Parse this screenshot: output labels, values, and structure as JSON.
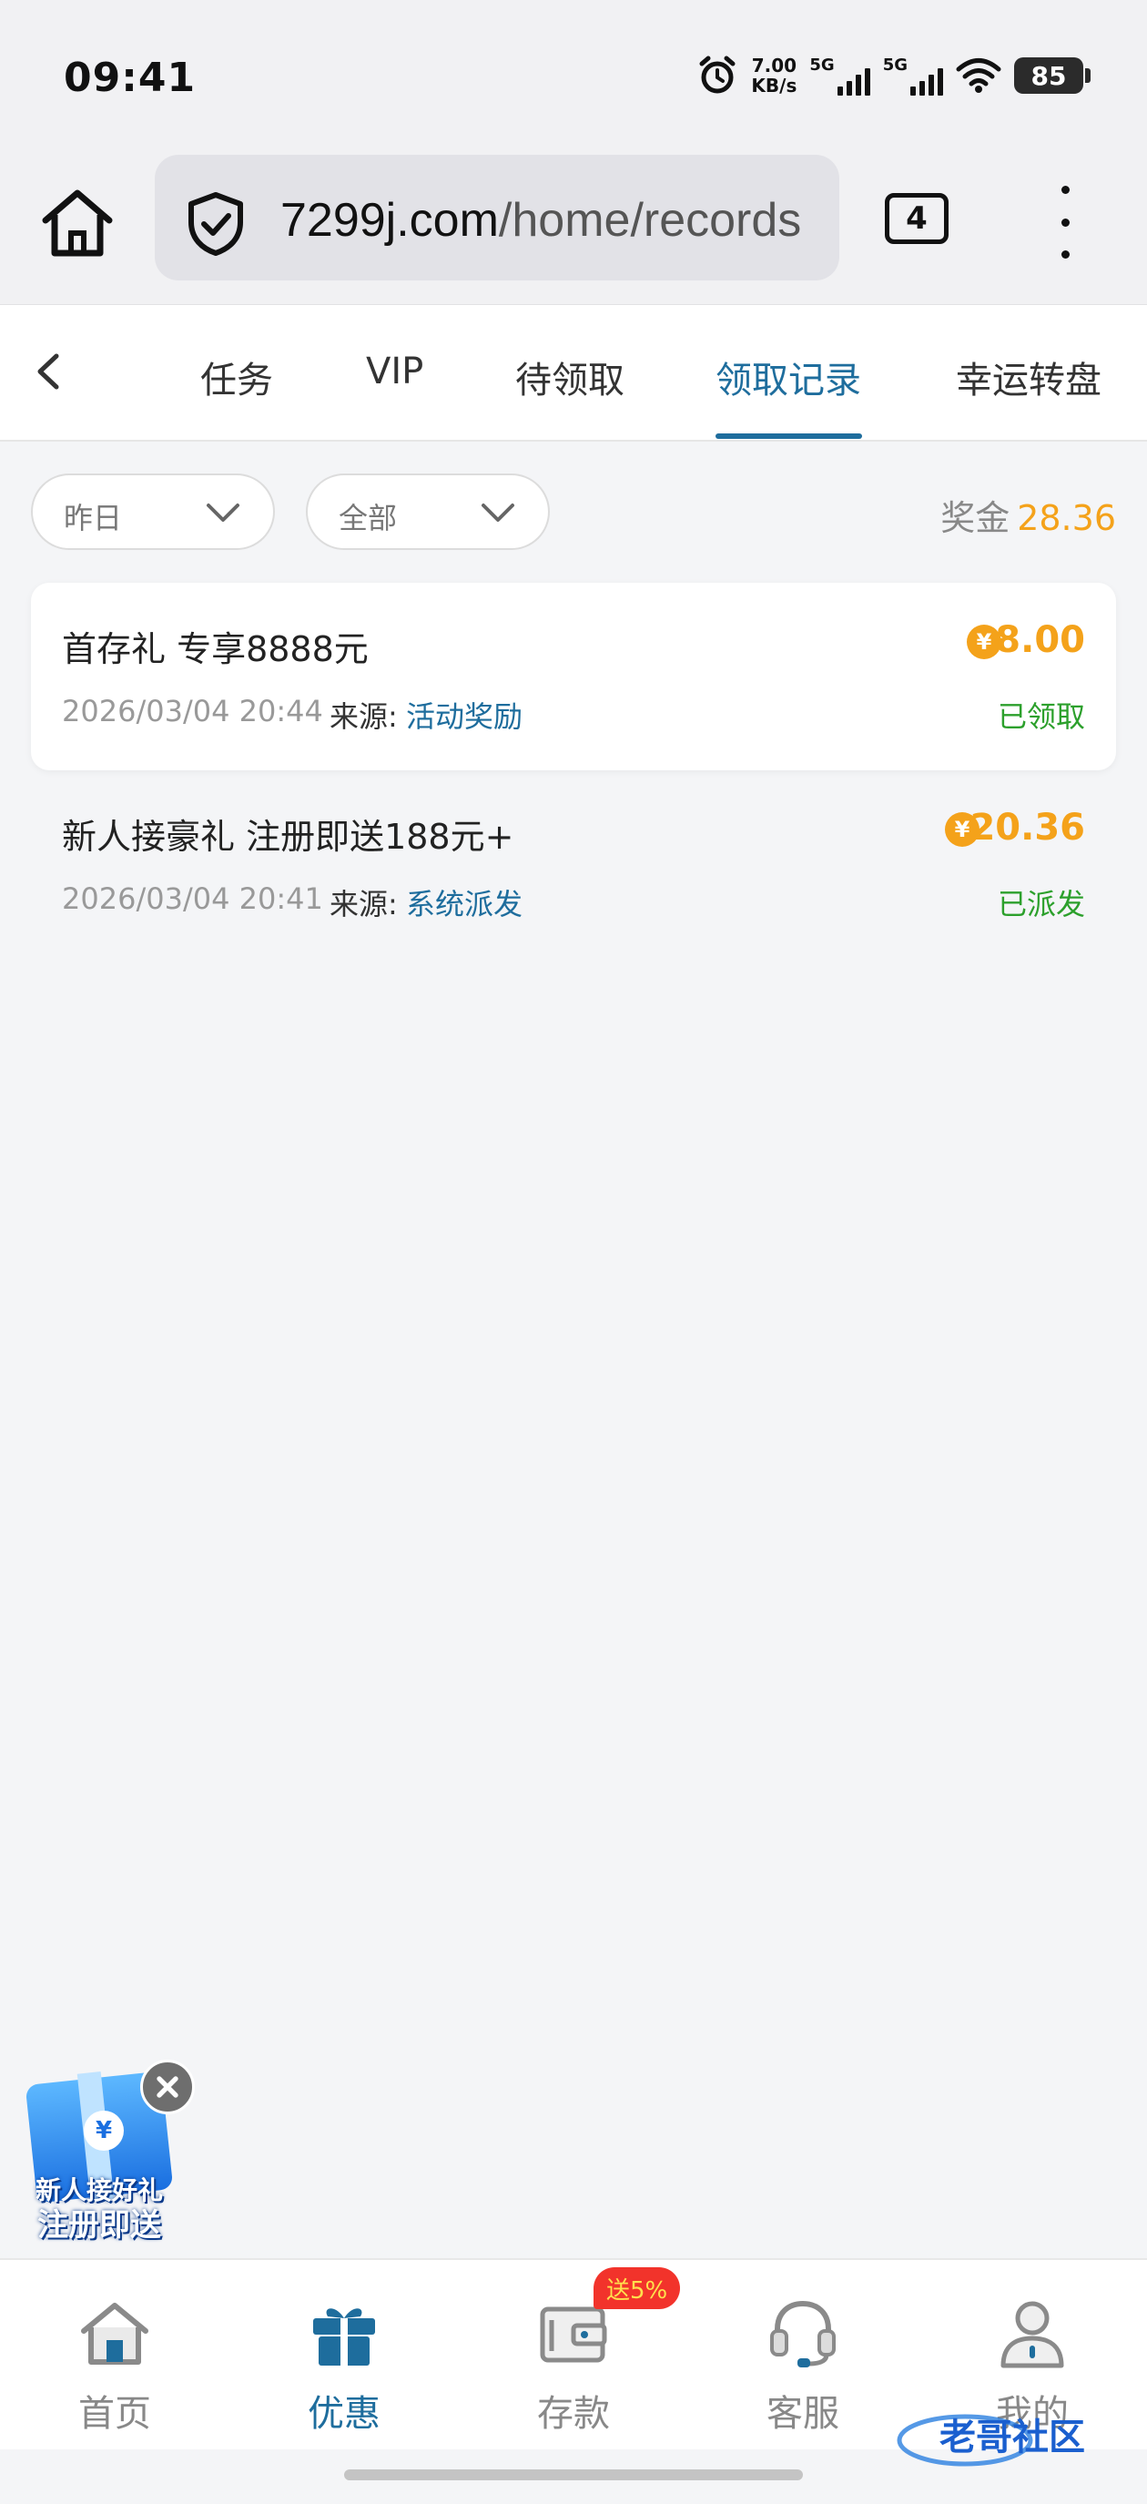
{
  "status_bar": {
    "time": "09:41",
    "net_speed_value": "7.00",
    "net_speed_unit": "KB/s",
    "sim1": "5G",
    "sim2": "5G",
    "battery": "85",
    "icons": [
      "alarm-icon",
      "signal-icon",
      "signal-icon",
      "wifi-icon",
      "battery-icon"
    ]
  },
  "browser": {
    "url_domain": "7299j.com",
    "url_path": "/home/records",
    "tab_count": "4",
    "icons": [
      "home-icon",
      "shield-check-icon",
      "tabs-icon",
      "more-icon"
    ]
  },
  "nav": {
    "tabs": [
      {
        "label": "任务",
        "active": false
      },
      {
        "label": "VIP",
        "active": false
      },
      {
        "label": "待领取",
        "active": false
      },
      {
        "label": "领取记录",
        "active": true
      },
      {
        "label": "幸运转盘",
        "active": false
      }
    ]
  },
  "filters": {
    "date": "昨日",
    "type": "全部"
  },
  "summary": {
    "label": "奖金",
    "amount": "28.36"
  },
  "records": [
    {
      "title": "首存礼 专享8888元",
      "amount": "8.00",
      "date": "2026/03/04 20:44",
      "source_label": "来源:",
      "source": "活动奖励",
      "status": "已领取"
    },
    {
      "title": "新人接豪礼 注册即送188元+",
      "amount": "20.36",
      "date": "2026/03/04 20:41",
      "source_label": "来源:",
      "source": "系统派发",
      "status": "已派发"
    }
  ],
  "promo": {
    "line1": "新人接好礼",
    "line2": "注册即送"
  },
  "bottom_nav": {
    "items": [
      {
        "label": "首页",
        "icon": "home-icon",
        "active": false
      },
      {
        "label": "优惠",
        "icon": "gift-icon",
        "active": true
      },
      {
        "label": "存款",
        "icon": "wallet-icon",
        "active": false
      },
      {
        "label": "客服",
        "icon": "headset-icon",
        "active": false
      },
      {
        "label": "我的",
        "icon": "user-icon",
        "active": false
      }
    ],
    "deposit_badge": "送5%"
  },
  "watermark": "老哥社区",
  "colors": {
    "accent": "#1e6d9d",
    "gold": "#f4a21a",
    "success": "#2ca02c",
    "badge": "#f2332b"
  }
}
